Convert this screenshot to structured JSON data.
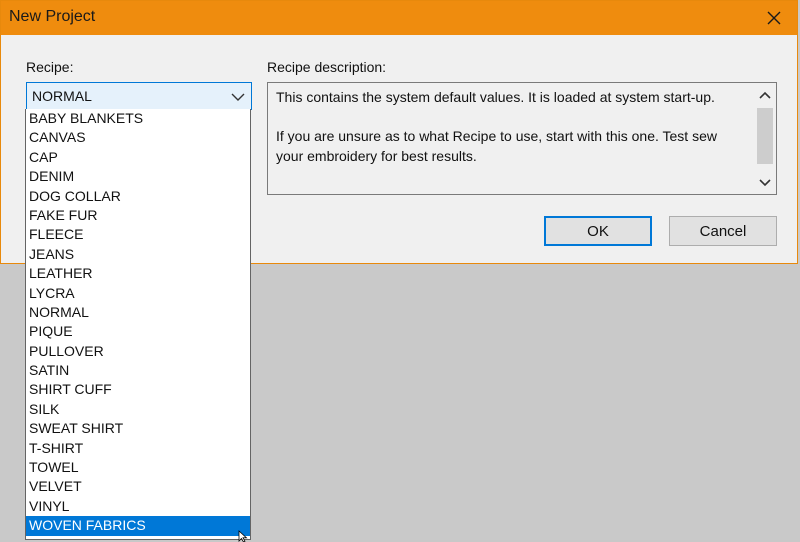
{
  "window": {
    "title": "New Project",
    "close_icon": "close-icon"
  },
  "recipe": {
    "label": "Recipe:",
    "selected": "NORMAL",
    "options": [
      "BABY BLANKETS",
      "CANVAS",
      "CAP",
      "DENIM",
      "DOG COLLAR",
      "FAKE FUR",
      "FLEECE",
      "JEANS",
      "LEATHER",
      "LYCRA",
      "NORMAL",
      "PIQUE",
      "PULLOVER",
      "SATIN",
      "SHIRT CUFF",
      "SILK",
      "SWEAT SHIRT",
      "T-SHIRT",
      "TOWEL",
      "VELVET",
      "VINYL",
      "WOVEN FABRICS"
    ],
    "highlighted_option": "WOVEN FABRICS"
  },
  "description": {
    "label": "Recipe description:",
    "text": "This contains the system default values. It is loaded at system start-up.\n\nIf you are unsure as to what Recipe to use, start with this one. Test sew your embroidery for best results."
  },
  "buttons": {
    "ok": "OK",
    "cancel": "Cancel"
  },
  "colors": {
    "title_bar": "#ef8c0e",
    "accent": "#0078d7",
    "dialog_bg": "#f0f0f0"
  }
}
